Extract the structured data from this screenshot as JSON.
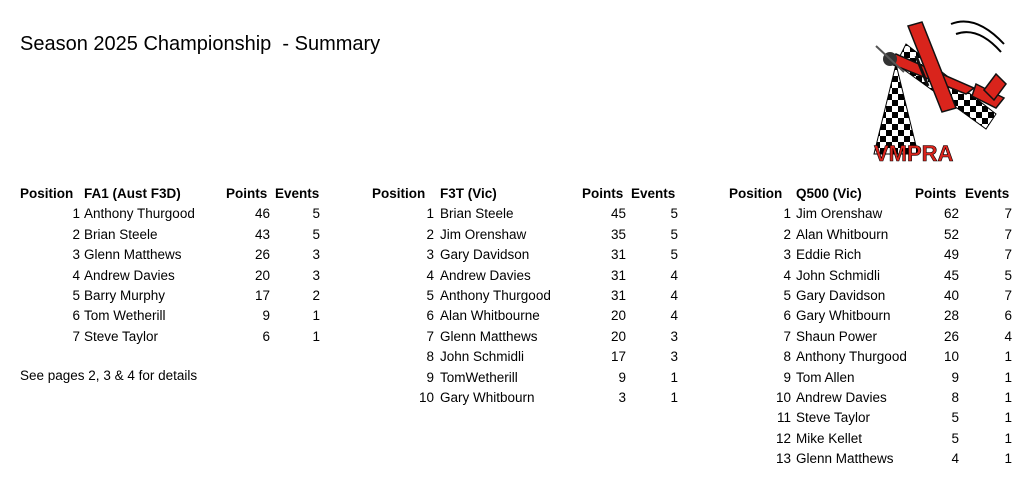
{
  "title": "Season 2025 Championship  - Summary",
  "logo": {
    "text": "VMPRA",
    "icon": "aerobatic-plane-checkered-flag-logo"
  },
  "note": "See pages 2, 3 & 4 for details",
  "tables": [
    {
      "headers": {
        "position": "Position",
        "class": "FA1 (Aust F3D)",
        "points": "Points",
        "events": "Events"
      },
      "rows": [
        {
          "pos": "1",
          "name": "Anthony Thurgood",
          "points": "46",
          "events": "5"
        },
        {
          "pos": "2",
          "name": "Brian Steele",
          "points": "43",
          "events": "5"
        },
        {
          "pos": "3",
          "name": "Glenn Matthews",
          "points": "26",
          "events": "3"
        },
        {
          "pos": "4",
          "name": "Andrew Davies",
          "points": "20",
          "events": "3"
        },
        {
          "pos": "5",
          "name": "Barry Murphy",
          "points": "17",
          "events": "2"
        },
        {
          "pos": "6",
          "name": "Tom Wetherill",
          "points": "9",
          "events": "1"
        },
        {
          "pos": "7",
          "name": "Steve Taylor",
          "points": "6",
          "events": "1"
        }
      ]
    },
    {
      "headers": {
        "position": "Position",
        "class": "F3T (Vic)",
        "points": "Points",
        "events": "Events"
      },
      "rows": [
        {
          "pos": "1",
          "name": "Brian Steele",
          "points": "45",
          "events": "5"
        },
        {
          "pos": "2",
          "name": "Jim Orenshaw",
          "points": "35",
          "events": "5"
        },
        {
          "pos": "3",
          "name": "Gary Davidson",
          "points": "31",
          "events": "5"
        },
        {
          "pos": "4",
          "name": "Andrew Davies",
          "points": "31",
          "events": "4"
        },
        {
          "pos": "5",
          "name": "Anthony Thurgood",
          "points": "31",
          "events": "4"
        },
        {
          "pos": "6",
          "name": "Alan Whitbourne",
          "points": "20",
          "events": "4"
        },
        {
          "pos": "7",
          "name": "Glenn Matthews",
          "points": "20",
          "events": "3"
        },
        {
          "pos": "8",
          "name": "John Schmidli",
          "points": "17",
          "events": "3"
        },
        {
          "pos": "9",
          "name": "TomWetherill",
          "points": "9",
          "events": "1"
        },
        {
          "pos": "10",
          "name": "Gary Whitbourn",
          "points": "3",
          "events": "1"
        }
      ]
    },
    {
      "headers": {
        "position": "Position",
        "class": "Q500 (Vic)",
        "points": "Points",
        "events": "Events"
      },
      "rows": [
        {
          "pos": "1",
          "name": "Jim Orenshaw",
          "points": "62",
          "events": "7"
        },
        {
          "pos": "2",
          "name": "Alan Whitbourn",
          "points": "52",
          "events": "7"
        },
        {
          "pos": "3",
          "name": "Eddie Rich",
          "points": "49",
          "events": "7"
        },
        {
          "pos": "4",
          "name": "John Schmidli",
          "points": "45",
          "events": "5"
        },
        {
          "pos": "5",
          "name": "Gary Davidson",
          "points": "40",
          "events": "7"
        },
        {
          "pos": "6",
          "name": "Gary Whitbourn",
          "points": "28",
          "events": "6"
        },
        {
          "pos": "7",
          "name": "Shaun Power",
          "points": "26",
          "events": "4"
        },
        {
          "pos": "8",
          "name": "Anthony Thurgood",
          "points": "10",
          "events": "1"
        },
        {
          "pos": "9",
          "name": "Tom Allen",
          "points": "9",
          "events": "1"
        },
        {
          "pos": "10",
          "name": "Andrew Davies",
          "points": "8",
          "events": "1"
        },
        {
          "pos": "11",
          "name": "Steve Taylor",
          "points": "5",
          "events": "1"
        },
        {
          "pos": "12",
          "name": "Mike Kellet",
          "points": "5",
          "events": "1"
        },
        {
          "pos": "13",
          "name": "Glenn Matthews",
          "points": "4",
          "events": "1"
        }
      ]
    }
  ]
}
